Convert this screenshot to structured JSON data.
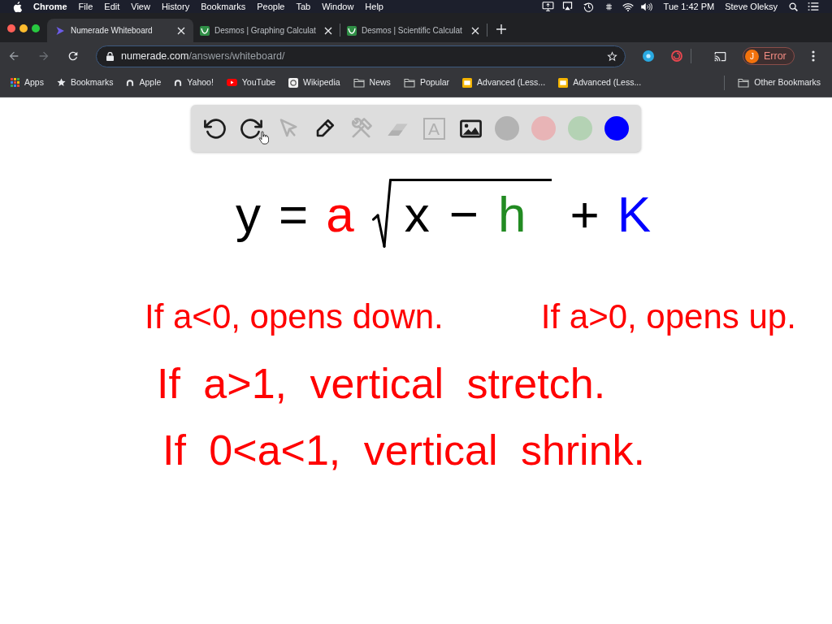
{
  "menu_bar": {
    "app": "Chrome",
    "menus": [
      "File",
      "Edit",
      "View",
      "History",
      "Bookmarks",
      "People",
      "Tab",
      "Window",
      "Help"
    ],
    "clock": "Tue 1:42 PM",
    "user": "Steve Oleksy"
  },
  "tabs": [
    {
      "kind": "numerade",
      "title": "Numerade Whiteboard",
      "selected": true
    },
    {
      "kind": "desmos",
      "title": "Desmos | Graphing Calculat",
      "selected": false
    },
    {
      "kind": "desmos",
      "title": "Desmos | Scientific Calculat",
      "selected": false
    }
  ],
  "address_bar": {
    "host": "numerade.com",
    "path": "/answers/whiteboard/"
  },
  "profile": {
    "initial": "J",
    "status": "Error"
  },
  "bookmarks": [
    {
      "kind": "apps",
      "label": "Apps"
    },
    {
      "kind": "star",
      "label": "Bookmarks"
    },
    {
      "kind": "arch",
      "label": "Apple"
    },
    {
      "kind": "arch",
      "label": "Yahoo!"
    },
    {
      "kind": "video",
      "label": "YouTube"
    },
    {
      "kind": "tile",
      "label": "Wikipedia"
    },
    {
      "kind": "folder",
      "label": "News"
    },
    {
      "kind": "folder",
      "label": "Popular"
    },
    {
      "kind": "document",
      "label": "Advanced (Less..."
    },
    {
      "kind": "document",
      "label": "Advanced (Less..."
    }
  ],
  "other_bookmarks": {
    "label": "Other Bookmarks"
  },
  "whiteboard_toolbar": {
    "tools": [
      {
        "kind": "undo",
        "disabled": false
      },
      {
        "kind": "redo",
        "disabled": false
      },
      {
        "kind": "select",
        "disabled": true
      },
      {
        "kind": "pen",
        "disabled": false
      },
      {
        "kind": "tools",
        "disabled": true
      },
      {
        "kind": "eraser",
        "disabled": true
      },
      {
        "kind": "text",
        "glyph": "A",
        "disabled": true
      },
      {
        "kind": "image",
        "disabled": false
      }
    ],
    "colors": [
      {
        "color": "#b3b3b3"
      },
      {
        "color": "#e8b4b6"
      },
      {
        "color": "#b4d2b4"
      },
      {
        "color": "#0000ff"
      }
    ]
  },
  "equation": [
    {
      "kind": "term",
      "text": "y",
      "color": "#000000"
    },
    {
      "kind": "term",
      "text": "=",
      "color": "#000000"
    },
    {
      "kind": "term",
      "text": "a",
      "color": "#ff0000"
    },
    {
      "kind": "radical",
      "children": [
        {
          "kind": "term",
          "text": "x",
          "color": "#000000"
        },
        {
          "kind": "term",
          "text": "−",
          "color": "#000000"
        },
        {
          "kind": "term",
          "text": "h",
          "color": "#228b22"
        }
      ]
    },
    {
      "kind": "term",
      "text": "+",
      "color": "#000000"
    },
    {
      "kind": "term",
      "text": "K",
      "color": "#0000ff"
    }
  ],
  "notes": [
    {
      "segments": [
        "If a<0, opens down.",
        "If a>0, opens up."
      ]
    },
    {
      "segments": [
        "If a>1, vertical stretch."
      ]
    },
    {
      "segments": [
        "If 0<a<1, vertical shrink."
      ]
    }
  ]
}
